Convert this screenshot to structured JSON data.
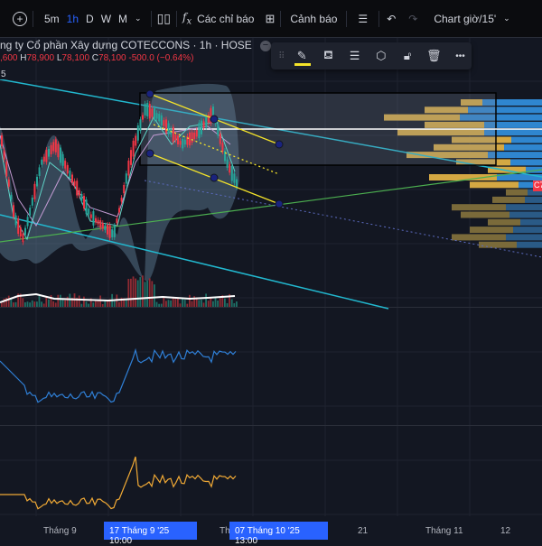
{
  "toolbar": {
    "intervals": [
      "5m",
      "1h",
      "D",
      "W",
      "M"
    ],
    "active_interval": "1h",
    "indicators_label": "Các chỉ báo",
    "alerts_label": "Cảnh báo",
    "layout_label": "Chart giờ/15'"
  },
  "legend": {
    "title": "ng ty Cổ phần Xây dựng COTECCONS · 1h · HOSE",
    "open": ",600",
    "high_key": "H",
    "high": "78,900",
    "low_key": "L",
    "low": "78,100",
    "close_key": "C",
    "close": "78,100",
    "change": "-500.0 (−0.64%)",
    "scale_tag": "5"
  },
  "price_tag": "C7",
  "colors": {
    "bg": "#131722",
    "up": "#26a69a",
    "down": "#f23645",
    "accent": "#2962ff",
    "channel": "#f5e42a",
    "trend": "#22b8cf"
  },
  "xaxis": {
    "labels": [
      "Tháng 9",
      "Th",
      "21",
      "Tháng 11",
      "12"
    ],
    "crosshair_start": "17 Tháng 9 '25   10:00",
    "crosshair_end": "07 Tháng 10 '25   13:00"
  }
}
